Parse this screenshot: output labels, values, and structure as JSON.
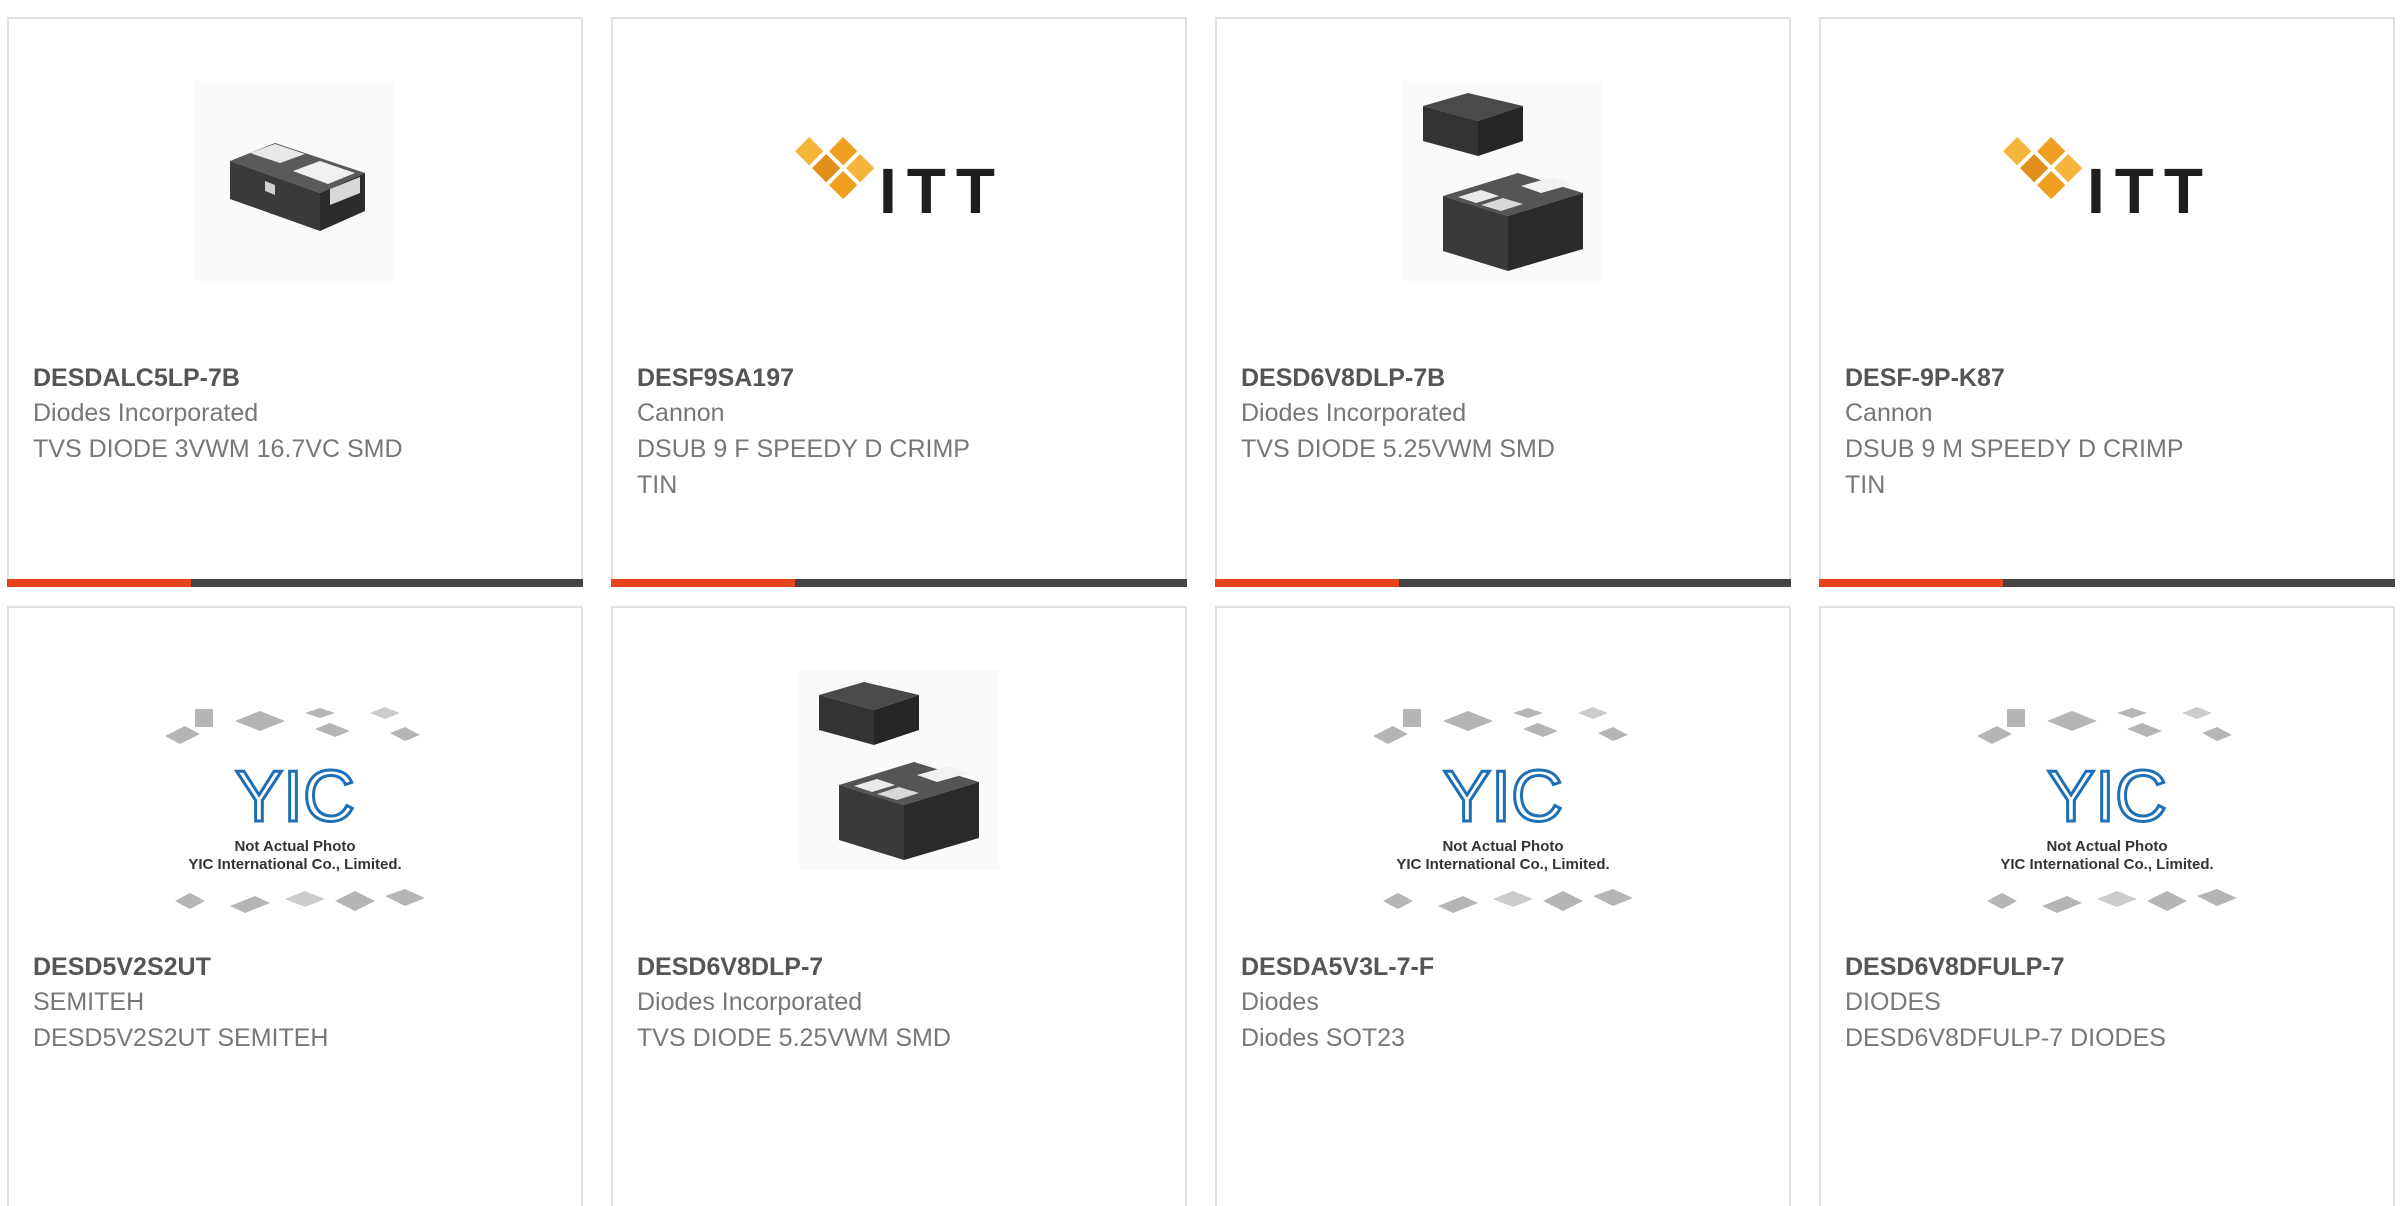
{
  "accent_color": "#e8421c",
  "bar_color": "#444444",
  "products": [
    {
      "part": "DESDALC5LP-7B",
      "manufacturer": "Diodes Incorporated",
      "description": "TVS DIODE 3VWM 16.7VC SMD",
      "image": "smd-diode-2pad-icon"
    },
    {
      "part": "DESF9SA197",
      "manufacturer": "Cannon",
      "description": "DSUB 9 F SPEEDY D CRIMP\nTIN",
      "image": "itt-logo",
      "logo_text": "ITT"
    },
    {
      "part": "DESD6V8DLP-7B",
      "manufacturer": "Diodes Incorporated",
      "description": "TVS DIODE 5.25VWM SMD",
      "image": "dfn-package-icon"
    },
    {
      "part": "DESF-9P-K87",
      "manufacturer": "Cannon",
      "description": "DSUB 9 M SPEEDY D CRIMP\nTIN",
      "image": "itt-logo",
      "logo_text": "ITT"
    },
    {
      "part": "DESD5V2S2UT",
      "manufacturer": "SEMITEH",
      "description": "DESD5V2S2UT SEMITEH",
      "image": "yic-placeholder",
      "placeholder_lines": [
        "Not Actual Photo",
        "YIC International Co., Limited."
      ]
    },
    {
      "part": "DESD6V8DLP-7",
      "manufacturer": "Diodes Incorporated",
      "description": "TVS DIODE 5.25VWM SMD",
      "image": "dfn-package-icon"
    },
    {
      "part": "DESDA5V3L-7-F",
      "manufacturer": "Diodes",
      "description": "Diodes SOT23",
      "image": "yic-placeholder",
      "placeholder_lines": [
        "Not Actual Photo",
        "YIC International Co., Limited."
      ]
    },
    {
      "part": "DESD6V8DFULP-7",
      "manufacturer": "DIODES",
      "description": "DESD6V8DFULP-7 DIODES",
      "image": "yic-placeholder",
      "placeholder_lines": [
        "Not Actual Photo",
        "YIC International Co., Limited."
      ]
    }
  ]
}
